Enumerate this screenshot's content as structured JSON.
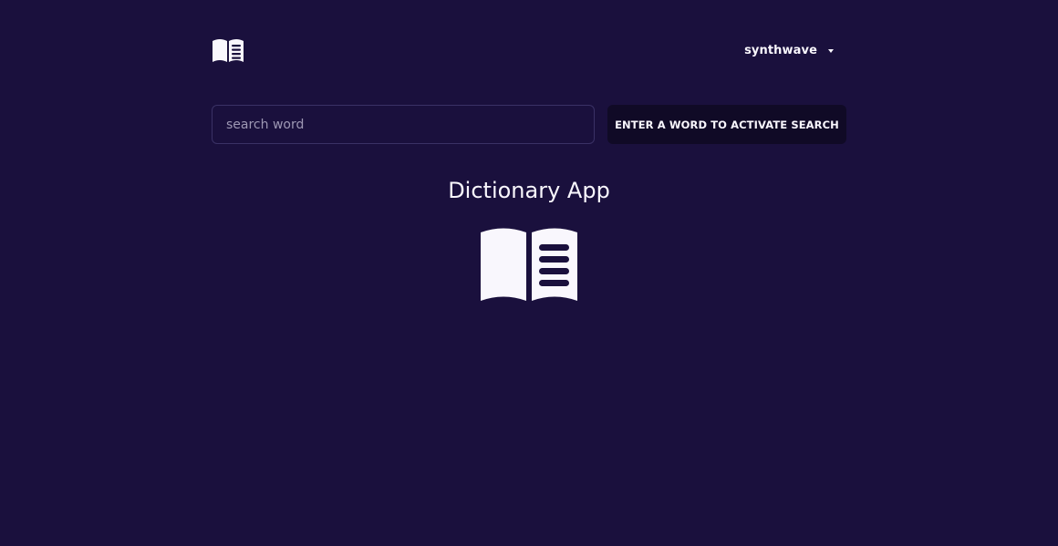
{
  "header": {
    "logo_icon": "open-book-icon",
    "theme": {
      "selected": "synthwave",
      "icon": "chevron-down-icon"
    }
  },
  "search": {
    "placeholder": "search word",
    "value": "",
    "button_label": "ENTER A WORD TO ACTIVATE SEARCH"
  },
  "main": {
    "title": "Dictionary App",
    "hero_icon": "open-book-icon"
  },
  "colors": {
    "background": "#1a103d",
    "text": "#f9f7fd",
    "button_background": "#100a26",
    "input_border": "#3a3165"
  }
}
